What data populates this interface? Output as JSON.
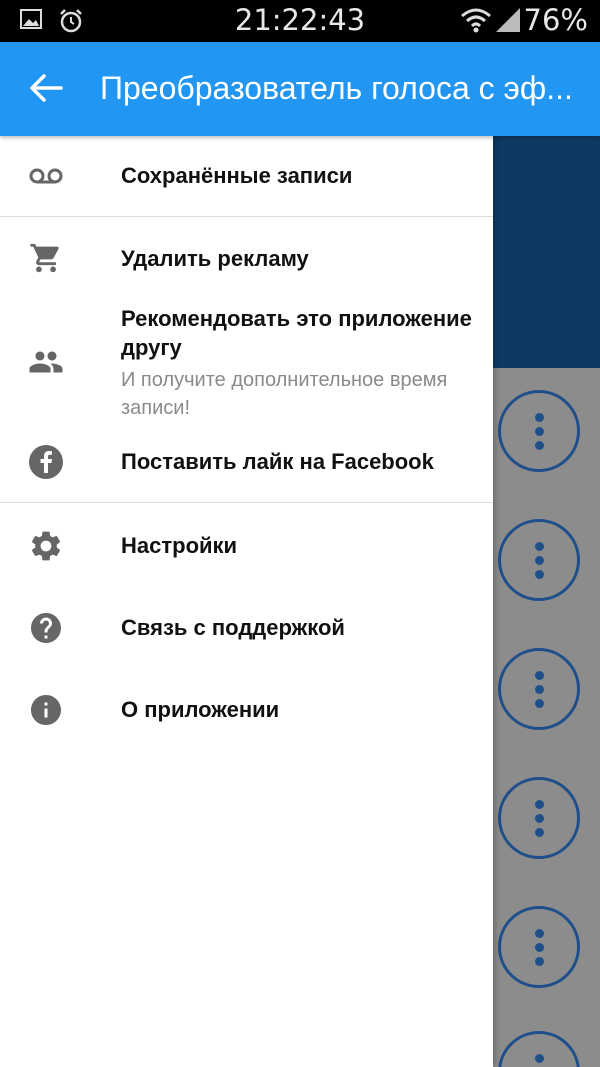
{
  "status_bar": {
    "time": "21:22:43",
    "battery": "76%",
    "icons": [
      "image-icon",
      "alarm-icon",
      "wifi-icon",
      "signal-icon"
    ]
  },
  "app_bar": {
    "title": "Преобразователь голоса с эф...",
    "back_icon": "arrow-back-icon",
    "color": "#2196f3"
  },
  "drawer": {
    "items": [
      {
        "label": "Сохранённые записи",
        "icon": "voicemail-icon"
      },
      {
        "label": "Удалить рекламу",
        "icon": "cart-icon"
      },
      {
        "label": "Рекомендовать это приложение другу",
        "sublabel": "И получите дополнительное время записи!",
        "icon": "people-icon"
      },
      {
        "label": "Поставить лайк на Facebook",
        "icon": "facebook-icon"
      },
      {
        "label": "Настройки",
        "icon": "gear-icon"
      },
      {
        "label": "Связь с поддержкой",
        "icon": "help-icon"
      },
      {
        "label": "О приложении",
        "icon": "info-icon"
      }
    ]
  },
  "background": {
    "header_color": "#0d3a63",
    "button_color": "#1f4f8a",
    "more_buttons": 6
  }
}
